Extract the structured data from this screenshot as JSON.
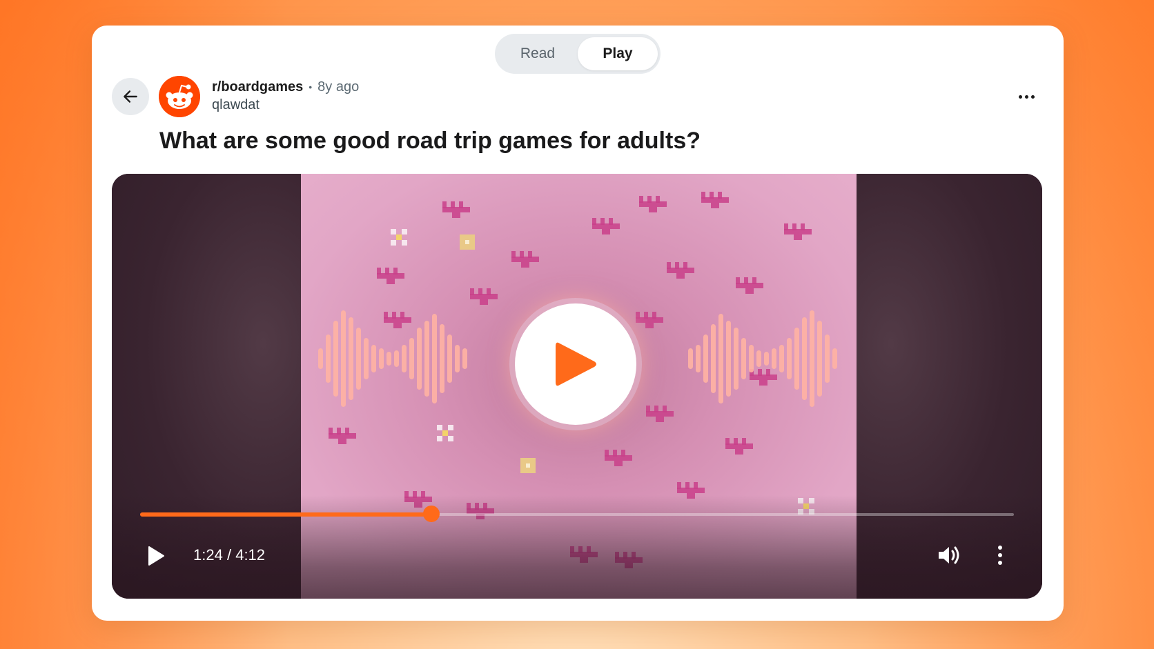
{
  "mode_toggle": {
    "read_label": "Read",
    "play_label": "Play",
    "active": "Play"
  },
  "post": {
    "subreddit": "r/boardgames",
    "separator": "•",
    "age": "8y ago",
    "author": "qlawdat",
    "title": "What are some good road trip games for adults?"
  },
  "player": {
    "current_time": "1:24",
    "time_separator": "/",
    "duration": "4:12",
    "progress_fraction": 0.333,
    "accent_color": "#ff6a1a"
  },
  "icons": {
    "back": "arrow-left-icon",
    "avatar": "reddit-snoo-icon",
    "more": "more-horizontal-icon",
    "big_play": "play-icon",
    "play": "play-icon",
    "volume": "volume-icon",
    "menu": "more-vertical-icon"
  }
}
